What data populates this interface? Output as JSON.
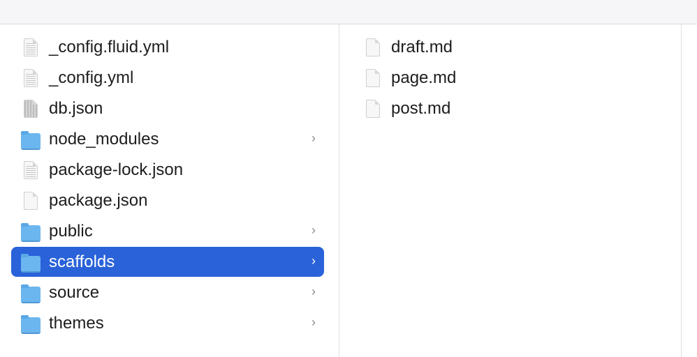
{
  "columns": [
    {
      "items": [
        {
          "name": "_config.fluid.yml",
          "icon": "yaml-file-icon",
          "kind": "text",
          "folder": false
        },
        {
          "name": "_config.yml",
          "icon": "yaml-file-icon",
          "kind": "text",
          "folder": false
        },
        {
          "name": "db.json",
          "icon": "json-file-icon",
          "kind": "dark",
          "folder": false
        },
        {
          "name": "node_modules",
          "icon": "folder-icon",
          "folder": true
        },
        {
          "name": "package-lock.json",
          "icon": "json-file-icon",
          "kind": "text",
          "folder": false
        },
        {
          "name": "package.json",
          "icon": "document-icon",
          "kind": "plain",
          "folder": false
        },
        {
          "name": "public",
          "icon": "folder-icon",
          "folder": true
        },
        {
          "name": "scaffolds",
          "icon": "folder-icon",
          "folder": true,
          "selected": true
        },
        {
          "name": "source",
          "icon": "folder-icon",
          "folder": true
        },
        {
          "name": "themes",
          "icon": "folder-icon",
          "folder": true
        }
      ]
    },
    {
      "items": [
        {
          "name": "draft.md",
          "icon": "document-icon",
          "kind": "plain",
          "folder": false
        },
        {
          "name": "page.md",
          "icon": "document-icon",
          "kind": "plain",
          "folder": false
        },
        {
          "name": "post.md",
          "icon": "document-icon",
          "kind": "plain",
          "folder": false
        }
      ]
    }
  ],
  "colors": {
    "selection": "#2962d9",
    "folder": "#6cb6ef",
    "toolbar": "#f6f5f7"
  }
}
